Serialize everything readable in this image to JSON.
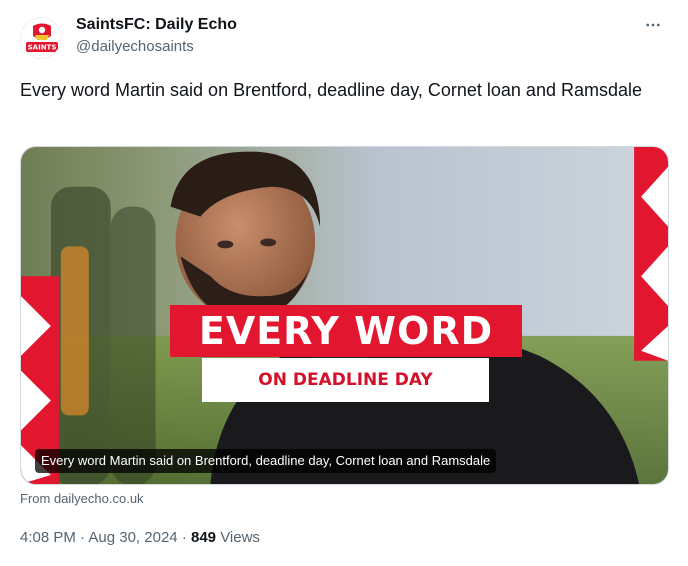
{
  "author": {
    "name": "SaintsFC: Daily Echo",
    "handle": "@dailyechosaints",
    "avatar_text": "SAINTS",
    "avatar_icon": "saints-crest-icon"
  },
  "tweet": {
    "text": "Every word Martin said on Brentford, deadline day, Cornet loan and Ramsdale",
    "more_icon": "more-options-icon"
  },
  "card": {
    "banner_main": "EVERY WORD",
    "banner_sub": "ON DEADLINE DAY",
    "caption": "Every word Martin said on Brentford, deadline day, Cornet loan and Ramsdale",
    "source": "From dailyecho.co.uk"
  },
  "meta": {
    "time": "4:08 PM",
    "date": "Aug 30, 2024",
    "separator": "·",
    "views_count": "849",
    "views_label": "Views"
  },
  "colors": {
    "brand_red": "#e3162f",
    "text_primary": "#0f1419",
    "text_secondary": "#536471"
  }
}
